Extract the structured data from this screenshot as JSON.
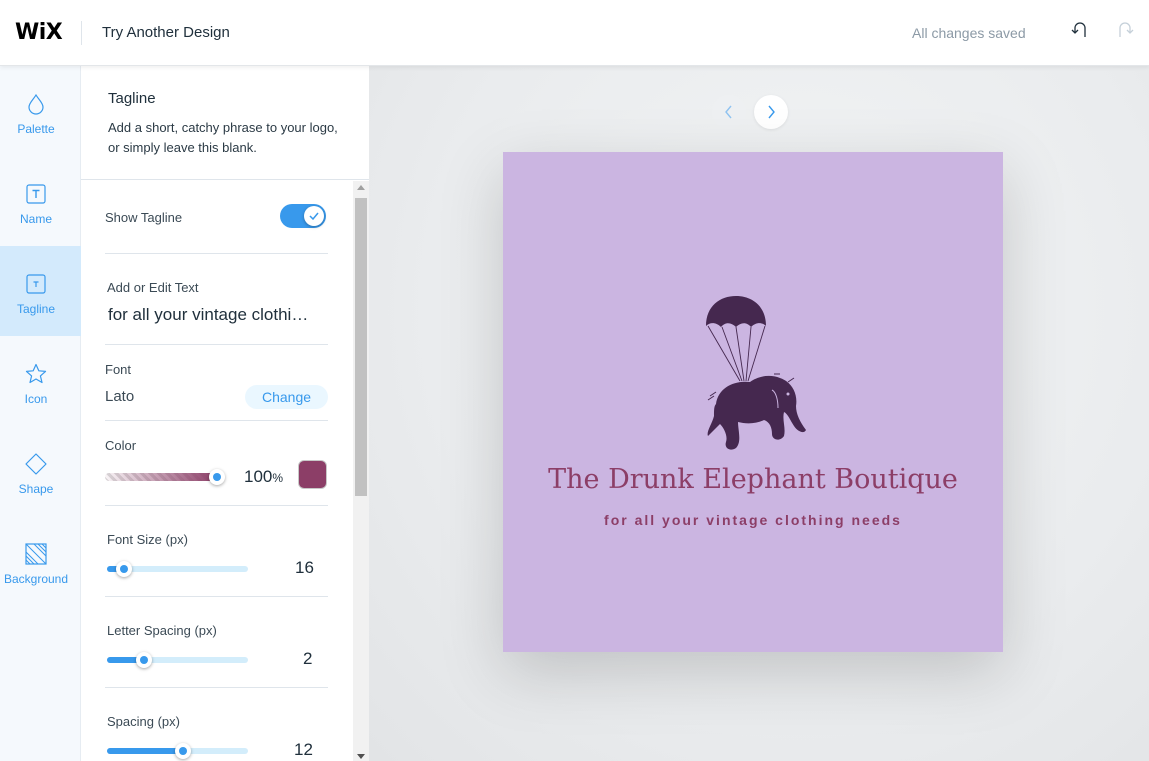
{
  "header": {
    "logo": "WiX",
    "title": "Try Another Design",
    "save_status": "All changes saved",
    "undo_icon": "undo-icon",
    "redo_icon": "redo-icon"
  },
  "sidebar": {
    "items": [
      {
        "label": "Palette",
        "icon": "droplet-icon",
        "active": false
      },
      {
        "label": "Name",
        "icon": "text-box-icon",
        "active": false
      },
      {
        "label": "Tagline",
        "icon": "text-box-small-icon",
        "active": true
      },
      {
        "label": "Icon",
        "icon": "star-icon",
        "active": false
      },
      {
        "label": "Shape",
        "icon": "diamond-icon",
        "active": false
      },
      {
        "label": "Background",
        "icon": "striped-square-icon",
        "active": false
      }
    ]
  },
  "panel": {
    "title": "Tagline",
    "description": "Add a short, catchy phrase to your logo, or simply leave this blank.",
    "show_tagline": {
      "label": "Show Tagline",
      "enabled": true
    },
    "edit_text": {
      "label": "Add or Edit Text",
      "value": "for all your vintage clothi…"
    },
    "font": {
      "label": "Font",
      "value": "Lato",
      "change_label": "Change"
    },
    "color": {
      "label": "Color",
      "opacity_value": "100",
      "opacity_unit": "%",
      "opacity_percent": 100,
      "swatch": "#8c3e67"
    },
    "font_size": {
      "label": "Font Size (px)",
      "value": "16",
      "fraction": 0.12
    },
    "letter_spacing": {
      "label": "Letter Spacing (px)",
      "value": "2",
      "fraction": 0.26
    },
    "spacing": {
      "label": "Spacing (px)",
      "value": "12",
      "fraction": 0.54
    }
  },
  "stage": {
    "prev_icon": "chevron-left-icon",
    "next_icon": "chevron-right-icon",
    "logo_preview": {
      "background": "#cbb5e1",
      "brand_name": "The Drunk Elephant Boutique",
      "tagline": "for all your vintage clothing needs",
      "icon": "parachuting-elephant-icon",
      "icon_color": "#45284f",
      "text_color": "#8c3e67"
    }
  },
  "colors": {
    "accent": "#3899ec",
    "active_tab_bg": "#d3eafc"
  }
}
